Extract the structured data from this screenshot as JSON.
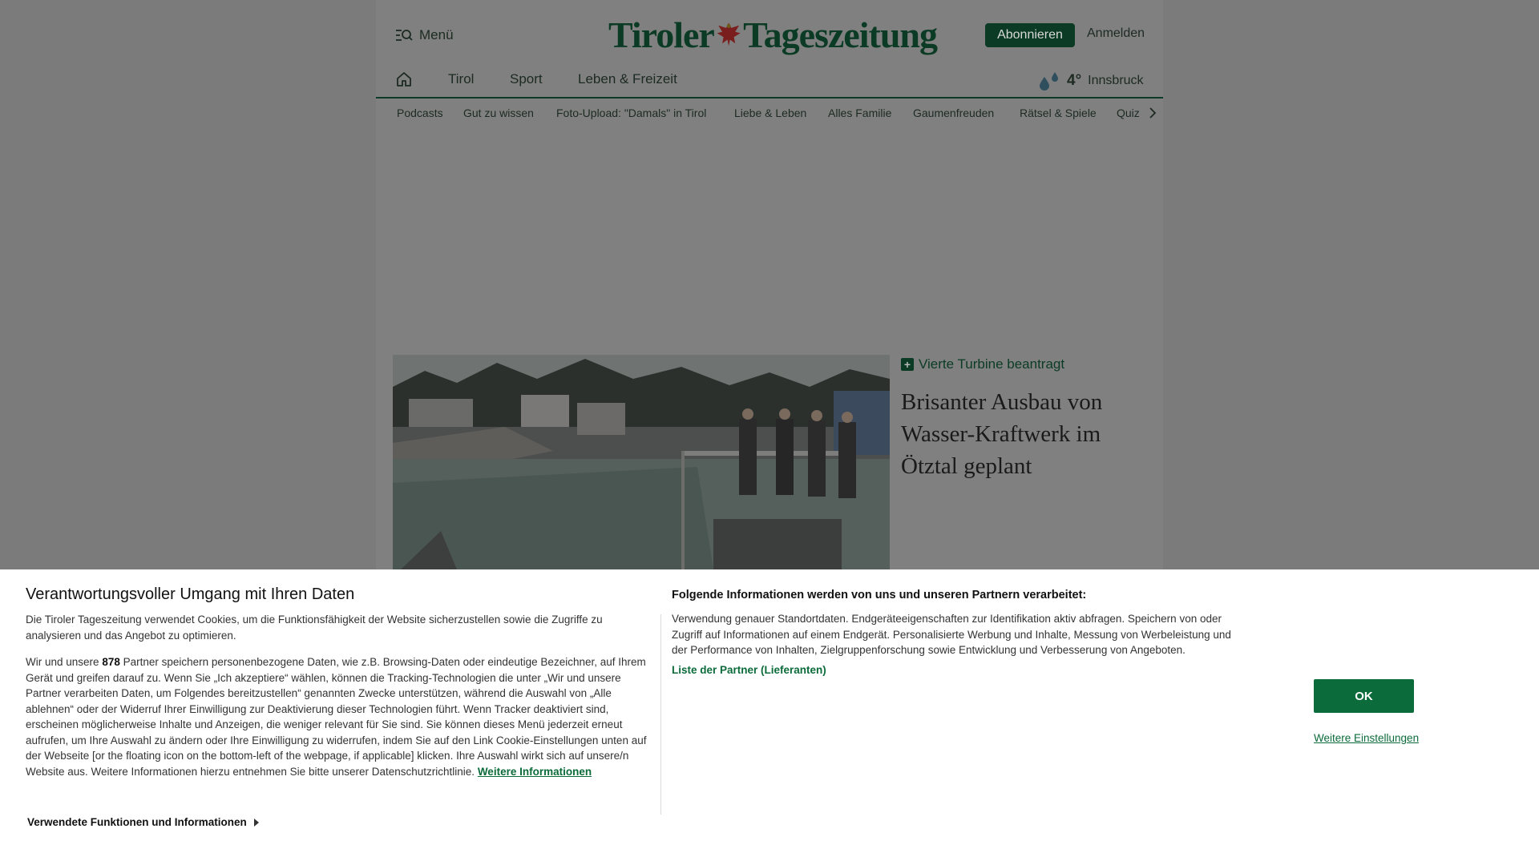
{
  "header": {
    "menu_label": "Menü",
    "logo_part1": "Tiroler",
    "logo_part2": "Tageszeitung",
    "subscribe_label": "Abonnieren",
    "login_label": "Anmelden"
  },
  "nav": {
    "items": [
      "Tirol",
      "Sport",
      "Leben & Freizeit"
    ],
    "weather": {
      "temp": "4°",
      "city": "Innsbruck"
    }
  },
  "subnav": {
    "items": [
      "Podcasts",
      "Gut zu wissen",
      "Foto-Upload: \"Damals\" in Tirol",
      "Liebe & Leben",
      "Alles Familie",
      "Gaumenfreuden",
      "Rätsel & Spiele",
      "Quiz"
    ]
  },
  "teaser": {
    "kicker": "Vierte Turbine beantragt",
    "title": "Brisanter Ausbau von Wasser-Kraftwerk im Ötztal geplant"
  },
  "consent": {
    "title": "Verantwortungsvoller Umgang mit Ihren Daten",
    "intro": "Die Tiroler Tageszeitung verwendet Cookies, um die Funktionsfähigkeit der Website sicherzustellen sowie die Zugriffe zu analysieren und das Angebot zu optimieren.",
    "body_pre": "Wir und unsere",
    "partner_count": "878",
    "body_post": "Partner speichern personenbezogene Daten, wie z.B. Browsing-Daten oder eindeutige Bezeichner, auf Ihrem Gerät und greifen darauf zu. Wenn Sie „Ich akzeptiere“ wählen, können die Tracking-Technologien die unter „Wir und unsere Partner verarbeiten Daten, um Folgendes bereitzustellen“ genannten Zwecke unterstützen, während die Auswahl von „Alle ablehnen“ oder der Widerruf Ihrer Einwilligung zur Deaktivierung dieser Technologien führt. Wenn Tracker deaktiviert sind, erscheinen möglicherweise Inhalte und Anzeigen, die weniger relevant für Sie sind. Sie können dieses Menü jederzeit erneut aufrufen, um Ihre Auswahl zu ändern oder Ihre Einwilligung zu widerrufen, indem Sie auf den Link Cookie-Einstellungen unten auf der Webseite [or the floating icon on the bottom-left of the webpage, if applicable] klicken. Ihre Auswahl wirkt sich auf unsere/n Website aus. Weitere Informationen hierzu entnehmen Sie bitte unserer Datenschutzrichtlinie.",
    "more_info_link": "Weitere Informationen",
    "right_title": "Folgende Informationen werden von uns und unseren Partnern verarbeitet:",
    "right_text": "Verwendung genauer Standortdaten. Endgeräteeigenschaften zur Identifikation aktiv abfragen. Speichern von oder Zugriff auf Informationen auf einem Endgerät. Personalisierte Werbung und Inhalte, Messung von Werbeleistung und der Performance von Inhalten, Zielgruppenforschung sowie Entwicklung und Verbesserung von Angeboten.",
    "partners_link": "Liste der Partner (Lieferanten)",
    "ok_label": "OK",
    "settings_link": "Weitere Einstellungen",
    "functions_label": "Verwendete Funktionen und Informationen"
  },
  "colors": {
    "brand_green": "#0b3b25",
    "link_green": "#0b6b3a",
    "overlay_gray": "#7b7b7b"
  }
}
